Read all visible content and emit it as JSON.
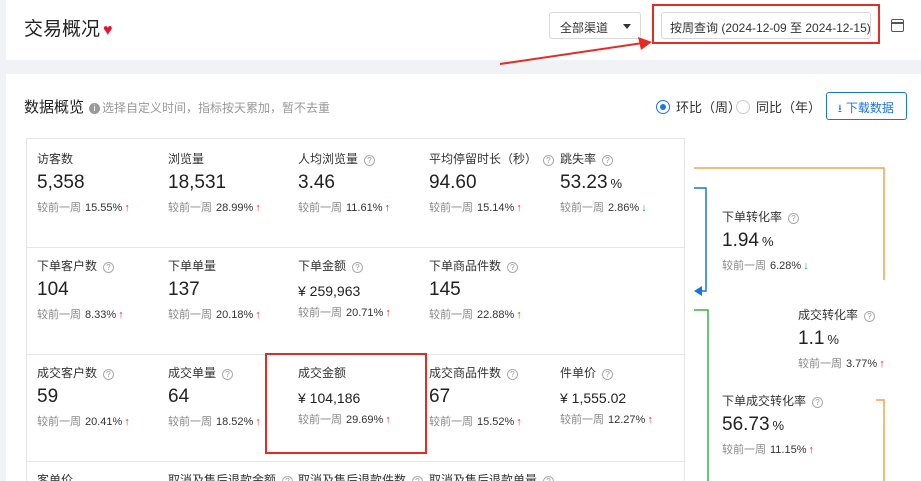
{
  "header": {
    "title": "交易概况",
    "channel": "全部渠道",
    "date_range": "按周查询  (2024-12-09 至 2024-12-15)"
  },
  "section": {
    "title": "数据概览",
    "hint": "选择自定义时间，指标按天累加，暂不去重",
    "radio_mom": "环比（周）",
    "radio_yoy": "同比（年）",
    "download": "下载数据",
    "compare_label": "较前一周"
  },
  "row1": [
    {
      "label": "访客数",
      "value": "5,358",
      "change": "15.55%",
      "dir": "up",
      "help": false
    },
    {
      "label": "浏览量",
      "value": "18,531",
      "change": "28.99%",
      "dir": "up",
      "help": false
    },
    {
      "label": "人均浏览量",
      "value": "3.46",
      "change": "11.61%",
      "dir": "up",
      "help": true
    },
    {
      "label": "平均停留时长（秒）",
      "value": "94.60",
      "change": "15.14%",
      "dir": "up",
      "help": true
    },
    {
      "label": "跳失率",
      "value": "53.23",
      "unit": "%",
      "change": "2.86%",
      "dir": "down",
      "help": true
    }
  ],
  "row2": [
    {
      "label": "下单客户数",
      "value": "104",
      "change": "8.33%",
      "dir": "up",
      "help": true
    },
    {
      "label": "下单单量",
      "value": "137",
      "change": "20.18%",
      "dir": "up",
      "help": false
    },
    {
      "label": "下单金额",
      "value": "¥ 259,963",
      "change": "20.71%",
      "dir": "up",
      "help": true
    },
    {
      "label": "下单商品件数",
      "value": "145",
      "change": "22.88%",
      "dir": "up",
      "help": true
    }
  ],
  "row3": [
    {
      "label": "成交客户数",
      "value": "59",
      "change": "20.41%",
      "dir": "up",
      "help": true
    },
    {
      "label": "成交单量",
      "value": "64",
      "change": "18.52%",
      "dir": "up",
      "help": true
    },
    {
      "label": "成交金额",
      "value": "¥ 104,186",
      "change": "29.69%",
      "dir": "up",
      "help": false
    },
    {
      "label": "成交商品件数",
      "value": "67",
      "change": "15.52%",
      "dir": "up",
      "help": true
    },
    {
      "label": "件单价",
      "value": "¥ 1,555.02",
      "change": "12.27%",
      "dir": "up",
      "help": true
    }
  ],
  "row4": [
    {
      "label": "客单价"
    },
    {
      "label": "取消及售后退款金额",
      "help": true
    },
    {
      "label": "取消及售后退款件数",
      "help": true
    },
    {
      "label": "取消及售后退款单量",
      "help": true
    }
  ],
  "funnel": [
    {
      "label": "下单转化率",
      "value": "1.94",
      "unit": "%",
      "change": "6.28%",
      "dir": "down"
    },
    {
      "label": "成交转化率",
      "value": "1.1",
      "unit": "%",
      "change": "3.77%",
      "dir": "up"
    },
    {
      "label": "下单成交转化率",
      "value": "56.73",
      "unit": "%",
      "change": "11.15%",
      "dir": "up"
    }
  ],
  "glyphs": {
    "up": "↑",
    "down": "↓",
    "help": "?",
    "info": "i",
    "heart": "♥",
    "download": "⭳"
  },
  "colors": {
    "accent": "#1a73e8",
    "up": "#e62b23",
    "down": "#1db043",
    "annotation": "#e62b23",
    "orange": "#f5a34b",
    "green": "#37b34a"
  }
}
